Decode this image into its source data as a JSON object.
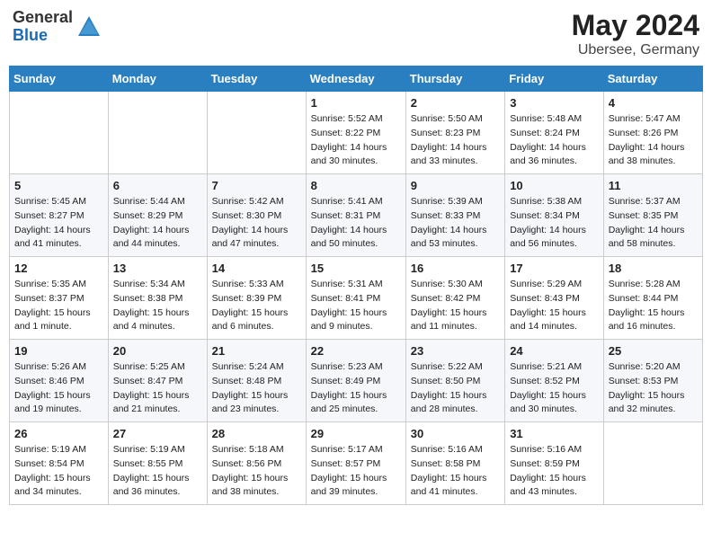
{
  "header": {
    "logo_general": "General",
    "logo_blue": "Blue",
    "month": "May 2024",
    "location": "Ubersee, Germany"
  },
  "weekdays": [
    "Sunday",
    "Monday",
    "Tuesday",
    "Wednesday",
    "Thursday",
    "Friday",
    "Saturday"
  ],
  "weeks": [
    [
      {
        "day": "",
        "info": ""
      },
      {
        "day": "",
        "info": ""
      },
      {
        "day": "",
        "info": ""
      },
      {
        "day": "1",
        "info": "Sunrise: 5:52 AM\nSunset: 8:22 PM\nDaylight: 14 hours and 30 minutes."
      },
      {
        "day": "2",
        "info": "Sunrise: 5:50 AM\nSunset: 8:23 PM\nDaylight: 14 hours and 33 minutes."
      },
      {
        "day": "3",
        "info": "Sunrise: 5:48 AM\nSunset: 8:24 PM\nDaylight: 14 hours and 36 minutes."
      },
      {
        "day": "4",
        "info": "Sunrise: 5:47 AM\nSunset: 8:26 PM\nDaylight: 14 hours and 38 minutes."
      }
    ],
    [
      {
        "day": "5",
        "info": "Sunrise: 5:45 AM\nSunset: 8:27 PM\nDaylight: 14 hours and 41 minutes."
      },
      {
        "day": "6",
        "info": "Sunrise: 5:44 AM\nSunset: 8:29 PM\nDaylight: 14 hours and 44 minutes."
      },
      {
        "day": "7",
        "info": "Sunrise: 5:42 AM\nSunset: 8:30 PM\nDaylight: 14 hours and 47 minutes."
      },
      {
        "day": "8",
        "info": "Sunrise: 5:41 AM\nSunset: 8:31 PM\nDaylight: 14 hours and 50 minutes."
      },
      {
        "day": "9",
        "info": "Sunrise: 5:39 AM\nSunset: 8:33 PM\nDaylight: 14 hours and 53 minutes."
      },
      {
        "day": "10",
        "info": "Sunrise: 5:38 AM\nSunset: 8:34 PM\nDaylight: 14 hours and 56 minutes."
      },
      {
        "day": "11",
        "info": "Sunrise: 5:37 AM\nSunset: 8:35 PM\nDaylight: 14 hours and 58 minutes."
      }
    ],
    [
      {
        "day": "12",
        "info": "Sunrise: 5:35 AM\nSunset: 8:37 PM\nDaylight: 15 hours and 1 minute."
      },
      {
        "day": "13",
        "info": "Sunrise: 5:34 AM\nSunset: 8:38 PM\nDaylight: 15 hours and 4 minutes."
      },
      {
        "day": "14",
        "info": "Sunrise: 5:33 AM\nSunset: 8:39 PM\nDaylight: 15 hours and 6 minutes."
      },
      {
        "day": "15",
        "info": "Sunrise: 5:31 AM\nSunset: 8:41 PM\nDaylight: 15 hours and 9 minutes."
      },
      {
        "day": "16",
        "info": "Sunrise: 5:30 AM\nSunset: 8:42 PM\nDaylight: 15 hours and 11 minutes."
      },
      {
        "day": "17",
        "info": "Sunrise: 5:29 AM\nSunset: 8:43 PM\nDaylight: 15 hours and 14 minutes."
      },
      {
        "day": "18",
        "info": "Sunrise: 5:28 AM\nSunset: 8:44 PM\nDaylight: 15 hours and 16 minutes."
      }
    ],
    [
      {
        "day": "19",
        "info": "Sunrise: 5:26 AM\nSunset: 8:46 PM\nDaylight: 15 hours and 19 minutes."
      },
      {
        "day": "20",
        "info": "Sunrise: 5:25 AM\nSunset: 8:47 PM\nDaylight: 15 hours and 21 minutes."
      },
      {
        "day": "21",
        "info": "Sunrise: 5:24 AM\nSunset: 8:48 PM\nDaylight: 15 hours and 23 minutes."
      },
      {
        "day": "22",
        "info": "Sunrise: 5:23 AM\nSunset: 8:49 PM\nDaylight: 15 hours and 25 minutes."
      },
      {
        "day": "23",
        "info": "Sunrise: 5:22 AM\nSunset: 8:50 PM\nDaylight: 15 hours and 28 minutes."
      },
      {
        "day": "24",
        "info": "Sunrise: 5:21 AM\nSunset: 8:52 PM\nDaylight: 15 hours and 30 minutes."
      },
      {
        "day": "25",
        "info": "Sunrise: 5:20 AM\nSunset: 8:53 PM\nDaylight: 15 hours and 32 minutes."
      }
    ],
    [
      {
        "day": "26",
        "info": "Sunrise: 5:19 AM\nSunset: 8:54 PM\nDaylight: 15 hours and 34 minutes."
      },
      {
        "day": "27",
        "info": "Sunrise: 5:19 AM\nSunset: 8:55 PM\nDaylight: 15 hours and 36 minutes."
      },
      {
        "day": "28",
        "info": "Sunrise: 5:18 AM\nSunset: 8:56 PM\nDaylight: 15 hours and 38 minutes."
      },
      {
        "day": "29",
        "info": "Sunrise: 5:17 AM\nSunset: 8:57 PM\nDaylight: 15 hours and 39 minutes."
      },
      {
        "day": "30",
        "info": "Sunrise: 5:16 AM\nSunset: 8:58 PM\nDaylight: 15 hours and 41 minutes."
      },
      {
        "day": "31",
        "info": "Sunrise: 5:16 AM\nSunset: 8:59 PM\nDaylight: 15 hours and 43 minutes."
      },
      {
        "day": "",
        "info": ""
      }
    ]
  ]
}
